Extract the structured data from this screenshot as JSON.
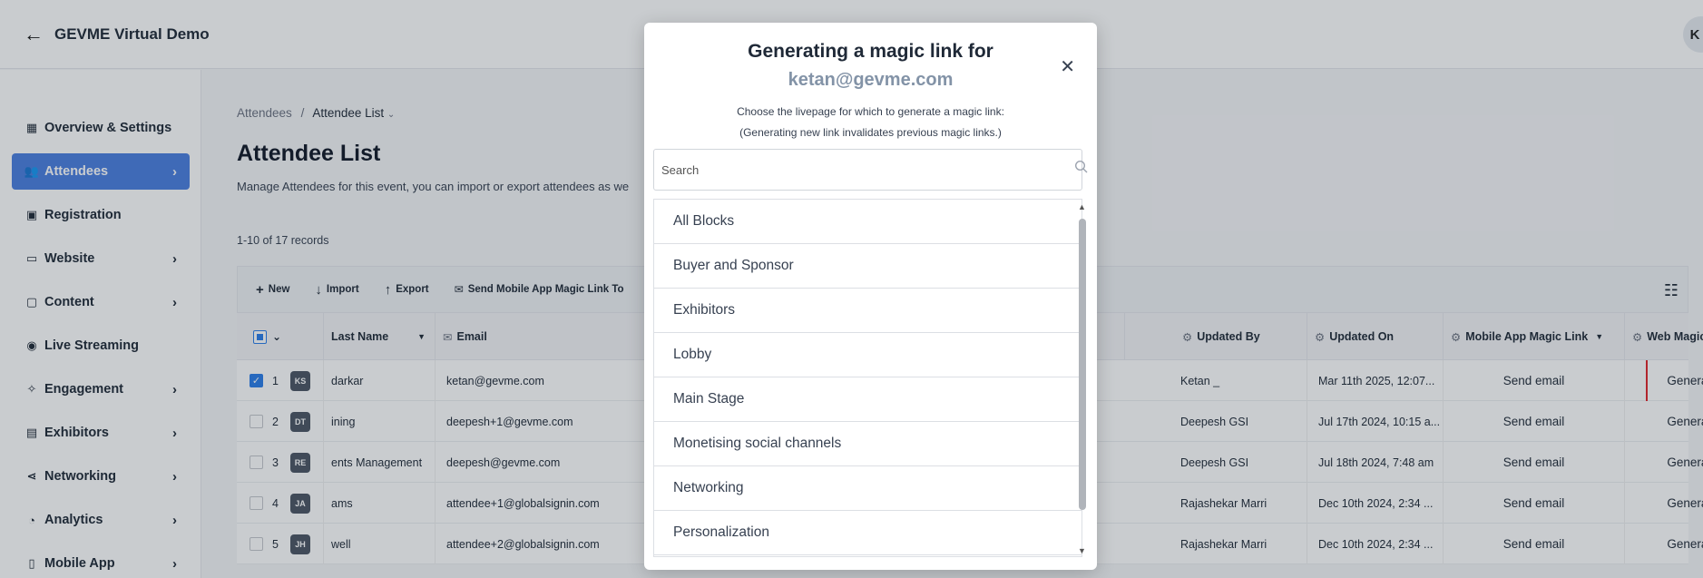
{
  "header": {
    "title": "GEVME Virtual Demo",
    "user_initial": "K"
  },
  "sidebar": {
    "items": [
      {
        "label": "Overview & Settings",
        "icon": "dashboard-icon",
        "chevron": false,
        "active": false
      },
      {
        "label": "Attendees",
        "icon": "people-icon",
        "chevron": true,
        "active": true
      },
      {
        "label": "Registration",
        "icon": "registration-icon",
        "chevron": false,
        "active": false
      },
      {
        "label": "Website",
        "icon": "website-icon",
        "chevron": true,
        "active": false
      },
      {
        "label": "Content",
        "icon": "folder-icon",
        "chevron": true,
        "active": false
      },
      {
        "label": "Live Streaming",
        "icon": "broadcast-icon",
        "chevron": false,
        "active": false
      },
      {
        "label": "Engagement",
        "icon": "engagement-icon",
        "chevron": true,
        "active": false
      },
      {
        "label": "Exhibitors",
        "icon": "exhibitor-icon",
        "chevron": true,
        "active": false
      },
      {
        "label": "Networking",
        "icon": "share-icon",
        "chevron": true,
        "active": false
      },
      {
        "label": "Analytics",
        "icon": "chart-icon",
        "chevron": true,
        "active": false
      },
      {
        "label": "Mobile App",
        "icon": "mobile-icon",
        "chevron": true,
        "active": false
      }
    ]
  },
  "breadcrumb": {
    "parent": "Attendees",
    "separator": "/",
    "current": "Attendee List"
  },
  "page": {
    "title": "Attendee List",
    "description": "Manage Attendees for this event, you can import or export attendees as we",
    "records": "1-10 of 17 records"
  },
  "toolbar": {
    "new": "New",
    "import": "Import",
    "export": "Export",
    "send_mobile": "Send Mobile App Magic Link To"
  },
  "table": {
    "headers": {
      "last_name": "Last Name",
      "email": "Email",
      "updated_by": "Updated By",
      "updated_on": "Updated On",
      "mobile_link": "Mobile App Magic Link",
      "web_link": "Web Magic Link"
    },
    "rows": [
      {
        "num": "1",
        "initials": "KS",
        "checked": true,
        "last_name": "darkar",
        "email": "ketan@gevme.com",
        "updated_by": "Ketan _",
        "updated_on": "Mar 11th 2025, 12:07...",
        "mobile": "Send email",
        "web": "Generate"
      },
      {
        "num": "2",
        "initials": "DT",
        "checked": false,
        "last_name": "ining",
        "email": "deepesh+1@gevme.com",
        "updated_by": "Deepesh GSI",
        "updated_on": "Jul 17th 2024, 10:15 a...",
        "mobile": "Send email",
        "web": "Generate"
      },
      {
        "num": "3",
        "initials": "RE",
        "checked": false,
        "last_name": "ents Management",
        "email": "deepesh@gevme.com",
        "updated_by": "Deepesh GSI",
        "updated_on": "Jul 18th 2024, 7:48 am",
        "mobile": "Send email",
        "web": "Generate"
      },
      {
        "num": "4",
        "initials": "JA",
        "checked": false,
        "last_name": "ams",
        "email": "attendee+1@globalsignin.com",
        "updated_by": "Rajashekar Marri",
        "updated_on": "Dec 10th 2024, 2:34 ...",
        "mobile": "Send email",
        "web": "Generate"
      },
      {
        "num": "5",
        "initials": "JH",
        "checked": false,
        "last_name": "well",
        "email": "attendee+2@globalsignin.com",
        "updated_by": "Rajashekar Marri",
        "updated_on": "Dec 10th 2024, 2:34 ...",
        "mobile": "Send email",
        "web": "Generate"
      }
    ]
  },
  "modal": {
    "title": "Generating a magic link for",
    "email": "ketan@gevme.com",
    "instruction": "Choose the livepage for which to generate a magic link:",
    "note": "(Generating new link invalidates previous magic links.)",
    "search_placeholder": "Search",
    "livepages": [
      "All Blocks",
      "Buyer and Sponsor",
      "Exhibitors",
      "Lobby",
      "Main Stage",
      "Monetising social channels",
      "Networking",
      "Personalization"
    ]
  }
}
